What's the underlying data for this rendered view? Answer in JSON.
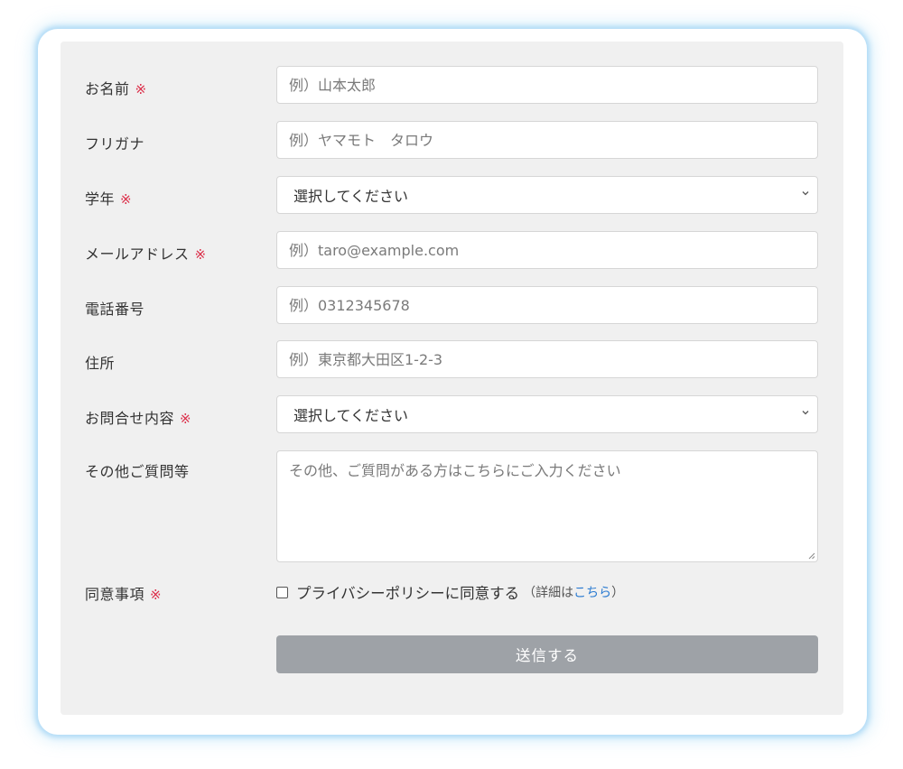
{
  "form": {
    "fields": [
      {
        "label": "お名前",
        "required_mark": "※",
        "placeholder": "例）山本太郎"
      },
      {
        "label": "フリガナ",
        "required_mark": "",
        "placeholder": "例）ヤマモト　タロウ"
      },
      {
        "label": "学年",
        "required_mark": "※",
        "selected": "選択してください"
      },
      {
        "label": "メールアドレス",
        "required_mark": "※",
        "placeholder": "例）taro@example.com"
      },
      {
        "label": "電話番号",
        "required_mark": "",
        "placeholder": "例）0312345678"
      },
      {
        "label": "住所",
        "required_mark": "",
        "placeholder": "例）東京都大田区1-2-3"
      },
      {
        "label": "お問合せ内容",
        "required_mark": "※",
        "selected": "選択してください"
      },
      {
        "label": "その他ご質問等",
        "required_mark": "",
        "placeholder": "その他、ご質問がある方はこちらにご入力ください"
      }
    ],
    "consent": {
      "label": "同意事項",
      "required_mark": "※",
      "checkbox_text": "プライバシーポリシーに同意する",
      "detail_open": "（詳細は",
      "detail_link": "こちら",
      "detail_close": "）",
      "checked": false
    },
    "submit_label": "送信する"
  },
  "colors": {
    "required": "#dc2f4a",
    "link": "#2b7bd1",
    "submit_bg": "#9ea2a7",
    "panel_bg": "#f0f0f0"
  },
  "icons": {
    "select_arrow": "chevron-down-icon",
    "textarea_resize": "resize-grip-icon"
  }
}
